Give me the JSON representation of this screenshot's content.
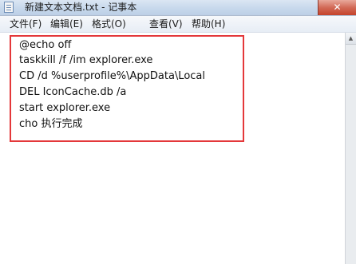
{
  "window": {
    "title": "新建文本文档.txt - 记事本",
    "close_label": "✕"
  },
  "menu": [
    {
      "label": "文件(F)"
    },
    {
      "label": "编辑(E)"
    },
    {
      "label": "格式(O)"
    },
    {
      "label": "查看(V)"
    },
    {
      "label": "帮助(H)"
    }
  ],
  "editor": {
    "lines": [
      "@echo off",
      "taskkill /f /im explorer.exe",
      "CD /d %userprofile%\\AppData\\Local",
      "DEL IconCache.db /a",
      "start explorer.exe",
      "cho 执行完成"
    ]
  },
  "scrollbar": {
    "up_arrow": "▲"
  },
  "colors": {
    "highlight_border": "#e4383a"
  }
}
